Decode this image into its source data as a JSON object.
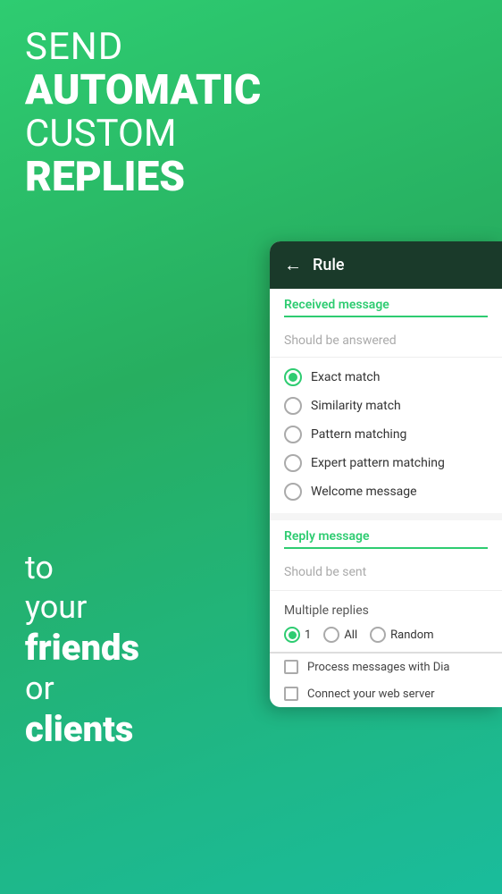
{
  "background": {
    "gradient_start": "#2ecc71",
    "gradient_end": "#1abc9c"
  },
  "hero": {
    "line1": "SEND",
    "line2": "AUTOMATIC",
    "line3": "CUSTOM",
    "line4": "REPLIES"
  },
  "bottom_text": {
    "line1": "to",
    "line2": "your",
    "line3": "friends",
    "line4": "or",
    "line5": "clients"
  },
  "card": {
    "header_title": "Rule",
    "back_arrow": "←",
    "received_label": "Received message",
    "received_placeholder": "Should be answered",
    "options": [
      {
        "label": "Exact match",
        "selected": true
      },
      {
        "label": "Similarity match",
        "selected": false
      },
      {
        "label": "Pattern matching",
        "selected": false
      },
      {
        "label": "Expert pattern matching",
        "selected": false
      },
      {
        "label": "Welcome message",
        "selected": false
      }
    ],
    "reply_label": "Reply message",
    "reply_placeholder": "Should be sent",
    "multiple_replies_label": "Multiple replies",
    "multi_options": [
      {
        "label": "1",
        "selected": true
      },
      {
        "label": "All",
        "selected": false
      },
      {
        "label": "Random",
        "selected": false
      }
    ],
    "checkboxes": [
      {
        "label": "Process messages with Dia"
      },
      {
        "label": "Connect your web server"
      }
    ]
  }
}
